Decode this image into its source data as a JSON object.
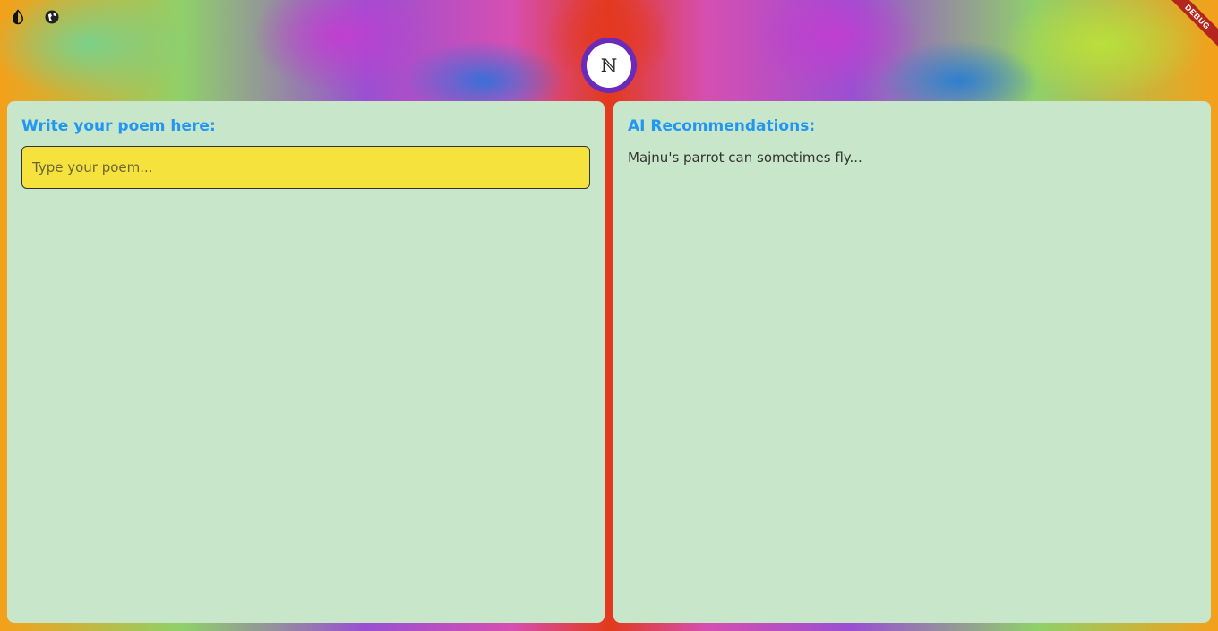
{
  "top_bar": {
    "icons": [
      "theme-toggle-icon",
      "colorize-icon"
    ]
  },
  "logo": {
    "letter": "ℕ"
  },
  "debug_banner": {
    "label": "DEBUG"
  },
  "editor_panel": {
    "title": "Write your poem here:",
    "input": {
      "value": "",
      "placeholder": "Type your poem..."
    }
  },
  "recommendations_panel": {
    "title": "AI Recommendations:",
    "text": "Majnu's parrot can sometimes fly..."
  },
  "colors": {
    "panel_background": "#c8e6c9",
    "title_color": "#2196f3",
    "input_background": "#f5e23c",
    "logo_ring": "#6a2bb8",
    "debug_ribbon": "#b3261e"
  }
}
